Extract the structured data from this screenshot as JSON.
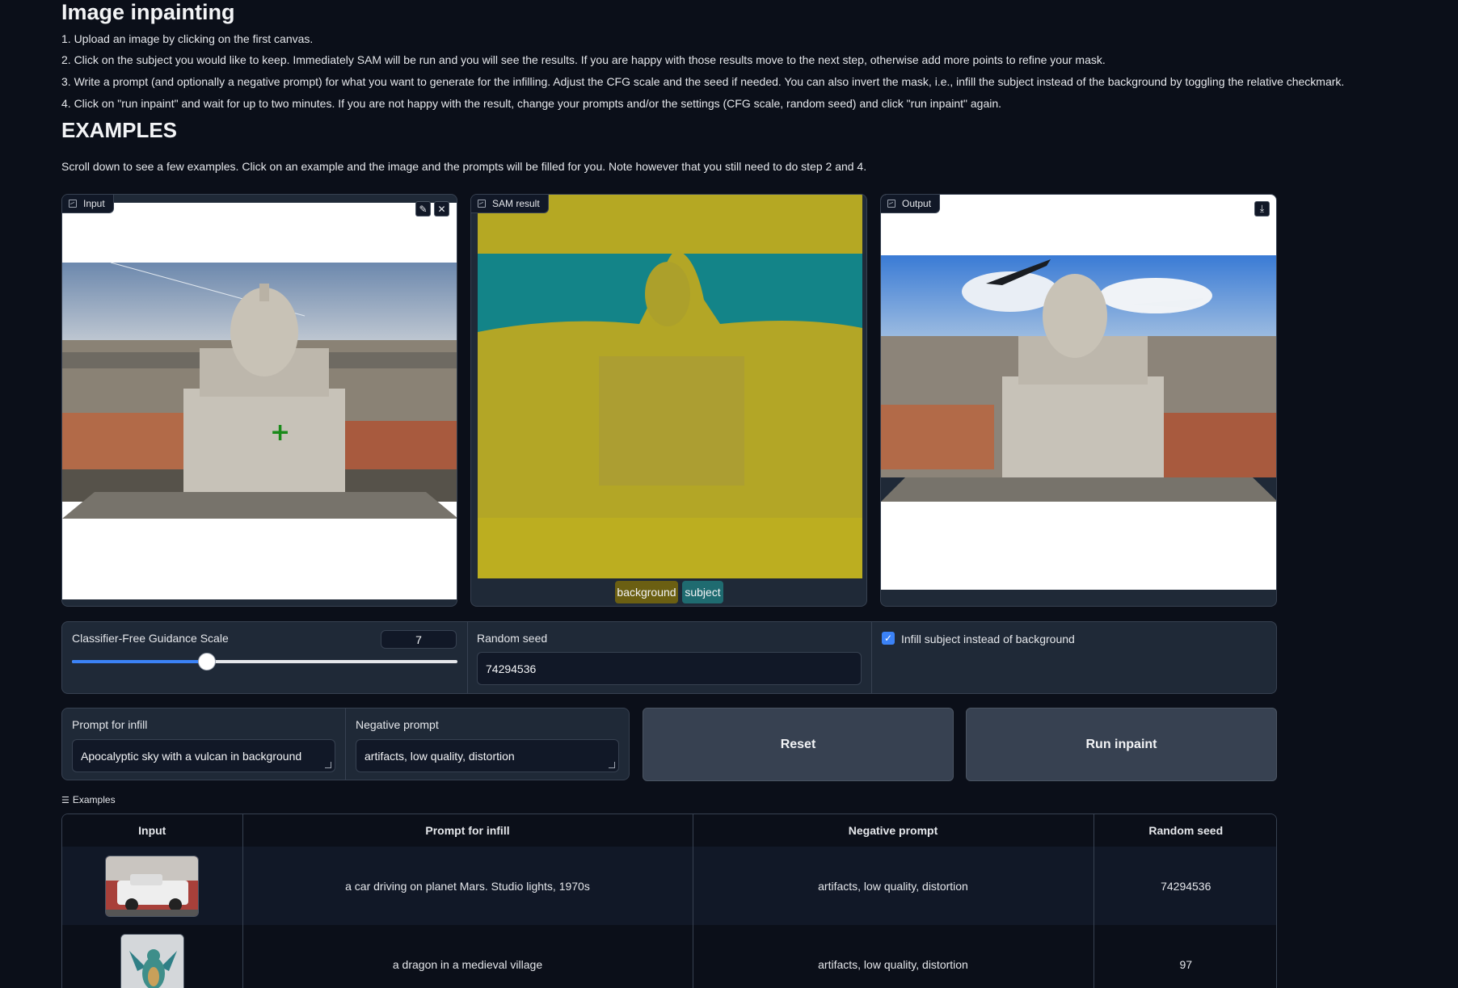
{
  "header": {
    "title": "Image inpainting",
    "steps": [
      "1. Upload an image by clicking on the first canvas.",
      "2. Click on the subject you would like to keep. Immediately SAM will be run and you will see the results. If you are happy with those results move to the next step, otherwise add more points to refine your mask.",
      "3. Write a prompt (and optionally a negative prompt) for what you want to generate for the infilling. Adjust the CFG scale and the seed if needed. You can also invert the mask, i.e., infill the subject instead of the background by toggling the relative checkmark.",
      "4. Click on \"run inpaint\" and wait for up to two minutes. If you are not happy with the result, change your prompts and/or the settings (CFG scale, random seed) and click \"run inpaint\" again."
    ],
    "examples_heading": "EXAMPLES",
    "examples_intro": "Scroll down to see a few examples. Click on an example and the image and the prompts will be filled for you. Note however that you still need to do step 2 and 4."
  },
  "panels": {
    "input_label": "Input",
    "sam_label": "SAM result",
    "output_label": "Output",
    "edit_icon": "pencil-icon",
    "clear_icon": "close-icon",
    "download_icon": "download-icon",
    "legend": [
      {
        "label": "background",
        "color": "#6b5f12"
      },
      {
        "label": "subject",
        "color": "#1f6b70"
      }
    ]
  },
  "controls": {
    "cfg_label": "Classifier-Free Guidance Scale",
    "cfg_value": "7",
    "cfg_fraction": 0.35,
    "seed_label": "Random seed",
    "seed_value": "74294536",
    "infill_checkbox_label": "Infill subject instead of background",
    "infill_checked": true,
    "prompt_label": "Prompt for infill",
    "prompt_value": "Apocalyptic sky with a vulcan in background",
    "negative_label": "Negative prompt",
    "negative_value": "artifacts, low quality, distortion",
    "reset_label": "Reset",
    "run_label": "Run inpaint"
  },
  "examples": {
    "toggle_label": "Examples",
    "columns": [
      "Input",
      "Prompt for infill",
      "Negative prompt",
      "Random seed"
    ],
    "rows": [
      {
        "thumb": "car",
        "prompt": "a car driving on planet Mars. Studio lights, 1970s",
        "negative": "artifacts, low quality, distortion",
        "seed": "74294536"
      },
      {
        "thumb": "dragon",
        "prompt": "a dragon in a medieval village",
        "negative": "artifacts, low quality, distortion",
        "seed": "97"
      }
    ]
  },
  "colors": {
    "accent": "#3b82f6",
    "mask_yellow": "#b5a823",
    "mask_teal": "#138488"
  }
}
